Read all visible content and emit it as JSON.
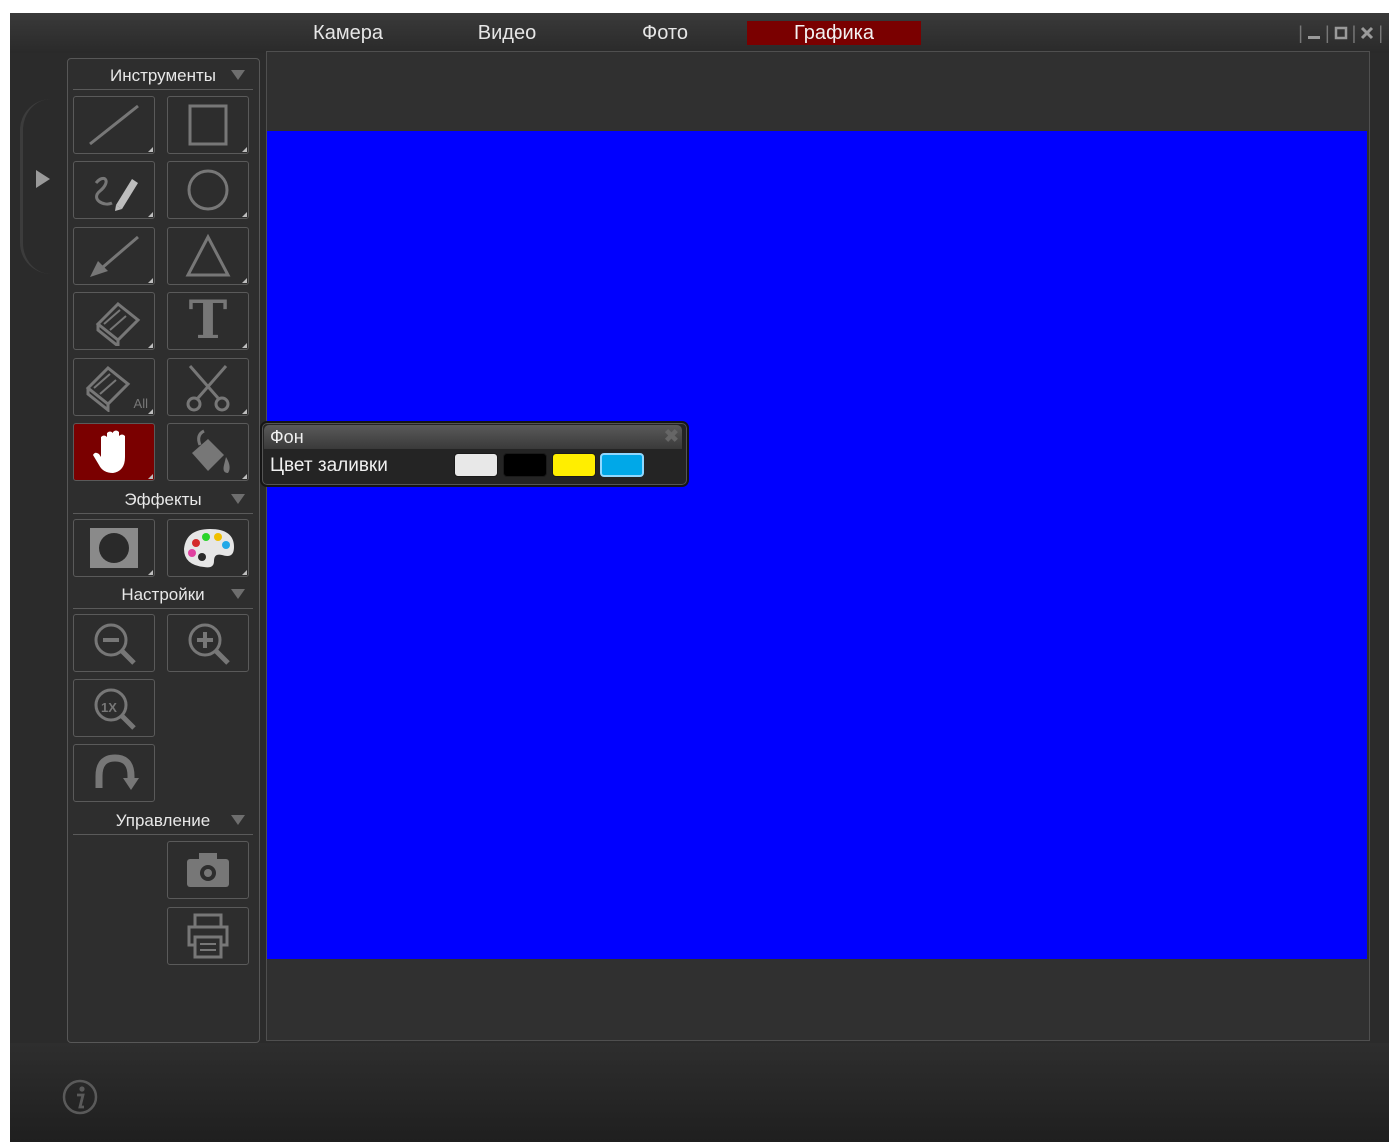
{
  "tabs": [
    "Камера",
    "Видео",
    "Фото",
    "Графика"
  ],
  "active_tab": "Графика",
  "window_controls": {
    "minimize": "minimize-icon",
    "maximize": "maximize-icon",
    "close": "close-icon"
  },
  "sidebar": {
    "tools": {
      "header": "Инструменты",
      "icons": [
        "line-icon",
        "rectangle-icon",
        "freehand-pen-icon",
        "circle-icon",
        "arrow-icon",
        "triangle-icon",
        "eraser-icon",
        "text-icon",
        "eraser-all-icon",
        "scissors-icon",
        "hand-icon",
        "fill-bucket-icon"
      ],
      "eraser_all_badge": "All",
      "text_glyph": "T",
      "active": "hand-icon"
    },
    "effects": {
      "header": "Эффекты",
      "icons": [
        "spotlight-icon",
        "palette-icon"
      ]
    },
    "settings": {
      "header": "Настройки",
      "icons": [
        "zoom-out-icon",
        "zoom-in-icon",
        "zoom-1x-icon",
        "rotate-icon"
      ],
      "zoom_1x_glyph": "1X"
    },
    "control": {
      "header": "Управление",
      "icons": [
        "camera-icon",
        "print-icon"
      ]
    }
  },
  "canvas": {
    "background_color": "#0000ff"
  },
  "popup": {
    "title": "Фон",
    "close_glyph": "✖",
    "label": "Цвет заливки",
    "swatches": [
      "#e8e8e8",
      "#000000",
      "#ffee00",
      "#00a8e8"
    ]
  },
  "colors": {
    "accent": "#7a0000",
    "panel": "#2b2b2b",
    "canvas": "#0000ff"
  },
  "info_icon": "info-icon"
}
